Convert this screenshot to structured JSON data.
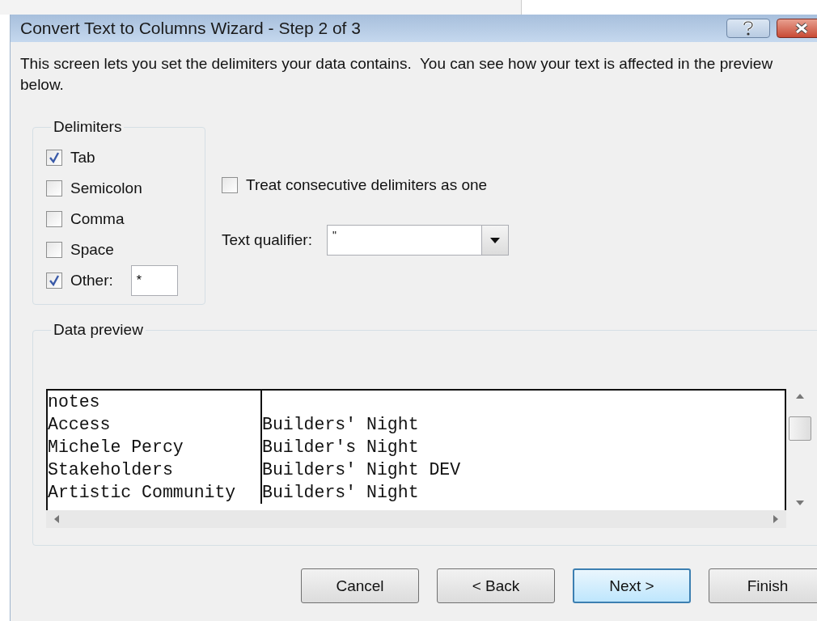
{
  "window": {
    "title": "Convert Text to Columns Wizard - Step 2 of 3"
  },
  "instructions": "This screen lets you set the delimiters your data contains.  You can see how your text is affected in the preview below.",
  "delimiters": {
    "title": "Delimiters",
    "options": [
      {
        "label": "Tab",
        "checked": true
      },
      {
        "label": "Semicolon",
        "checked": false
      },
      {
        "label": "Comma",
        "checked": false
      },
      {
        "label": "Space",
        "checked": false
      },
      {
        "label": "Other:",
        "checked": true,
        "value": "*"
      }
    ]
  },
  "consecutive": {
    "label": "Treat consecutive delimiters as one",
    "checked": false
  },
  "text_qualifier": {
    "label": "Text qualifier:",
    "value": "\""
  },
  "preview": {
    "title": "Data preview",
    "rows": [
      {
        "column_1": "notes"
      },
      {
        "column_1": "Access",
        "column_2": "Builders' Night"
      },
      {
        "column_1": "Michele Percy",
        "column_2": "Builder's Night"
      },
      {
        "column_1": "Stakeholders",
        "column_2": "Builders' Night DEV"
      },
      {
        "column_1": "Artistic Community",
        "column_2": "Builders' Night"
      }
    ]
  },
  "buttons": [
    {
      "label": "Cancel",
      "default": false
    },
    {
      "label": "< Back",
      "default": false
    },
    {
      "label": "Next >",
      "default": true
    },
    {
      "label": "Finish",
      "default": false
    }
  ]
}
